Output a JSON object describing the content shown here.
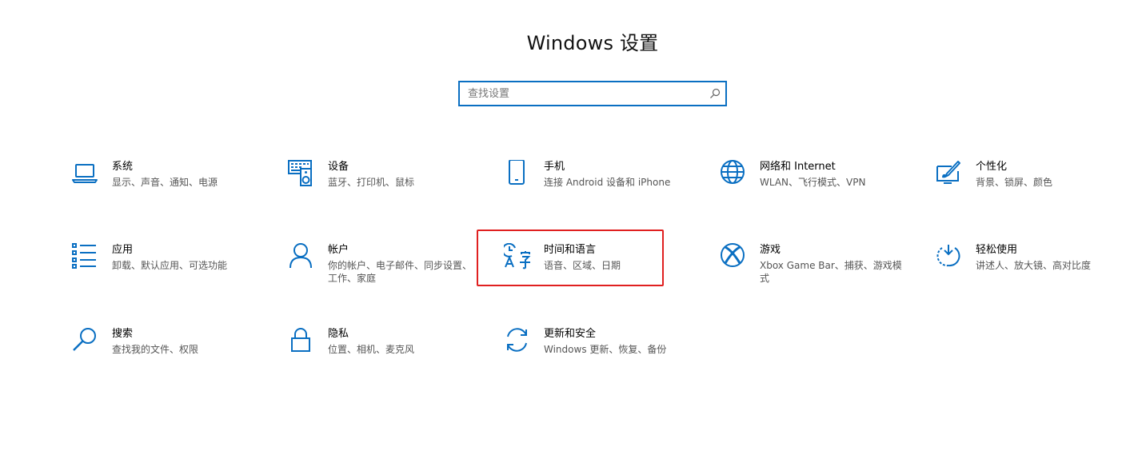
{
  "page_title": "Windows 设置",
  "search": {
    "placeholder": "查找设置",
    "value": ""
  },
  "accent_color": "#0a6fc2",
  "highlight_color": "#e02020",
  "tiles": [
    {
      "icon": "laptop-icon",
      "title": "系统",
      "desc": "显示、声音、通知、电源"
    },
    {
      "icon": "keyboard-speaker-icon",
      "title": "设备",
      "desc": "蓝牙、打印机、鼠标"
    },
    {
      "icon": "phone-icon",
      "title": "手机",
      "desc": "连接 Android 设备和 iPhone"
    },
    {
      "icon": "globe-icon",
      "title": "网络和 Internet",
      "desc": "WLAN、飞行模式、VPN"
    },
    {
      "icon": "paint-brush-icon",
      "title": "个性化",
      "desc": "背景、锁屏、颜色"
    },
    {
      "icon": "app-list-icon",
      "title": "应用",
      "desc": "卸载、默认应用、可选功能"
    },
    {
      "icon": "person-icon",
      "title": "帐户",
      "desc": "你的帐户、电子邮件、同步设置、工作、家庭"
    },
    {
      "icon": "time-language-icon",
      "title": "时间和语言",
      "desc": "语音、区域、日期"
    },
    {
      "icon": "xbox-icon",
      "title": "游戏",
      "desc": "Xbox Game Bar、捕获、游戏模式"
    },
    {
      "icon": "ease-of-access-icon",
      "title": "轻松使用",
      "desc": "讲述人、放大镜、高对比度"
    },
    {
      "icon": "search-icon",
      "title": "搜索",
      "desc": "查找我的文件、权限"
    },
    {
      "icon": "lock-icon",
      "title": "隐私",
      "desc": "位置、相机、麦克风"
    },
    {
      "icon": "sync-icon",
      "title": "更新和安全",
      "desc": "Windows 更新、恢复、备份"
    }
  ]
}
